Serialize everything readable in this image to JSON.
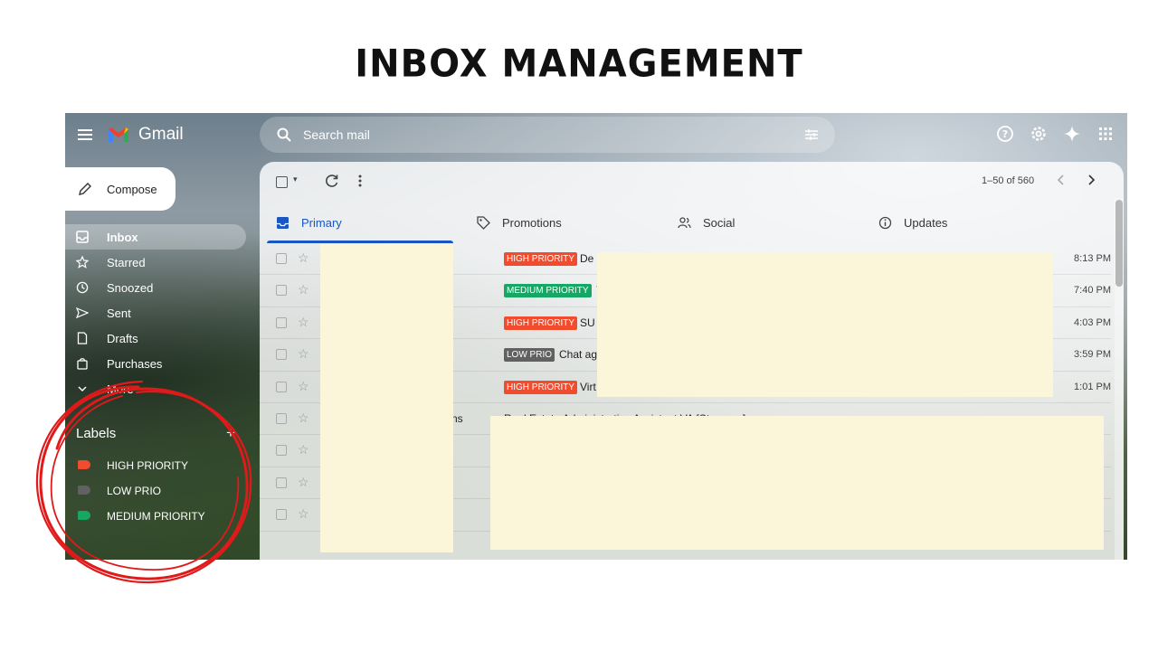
{
  "slide": {
    "title": "INBOX MANAGEMENT"
  },
  "header": {
    "app_name": "Gmail",
    "search_placeholder": "Search mail",
    "icons": [
      "menu-icon",
      "help-icon",
      "settings-icon",
      "gemini-sparkle-icon",
      "apps-grid-icon",
      "search-icon",
      "filter-icon"
    ]
  },
  "compose": {
    "label": "Compose"
  },
  "sidebar": {
    "items": [
      {
        "label": "Inbox",
        "icon": "inbox-icon",
        "active": true
      },
      {
        "label": "Starred",
        "icon": "star-icon"
      },
      {
        "label": "Snoozed",
        "icon": "clock-icon"
      },
      {
        "label": "Sent",
        "icon": "send-icon"
      },
      {
        "label": "Drafts",
        "icon": "draft-icon"
      },
      {
        "label": "Purchases",
        "icon": "shopping-bag-icon"
      },
      {
        "label": "More",
        "icon": "chevron-down-icon"
      }
    ],
    "labels_heading": "Labels",
    "labels_add": "+",
    "labels": [
      {
        "label": "HIGH PRIORITY",
        "color": "#f14c2e"
      },
      {
        "label": "LOW PRIO",
        "color": "#616161"
      },
      {
        "label": "MEDIUM PRIORITY",
        "color": "#16a765"
      }
    ]
  },
  "toolbar": {
    "page_range": "1–50 of 560",
    "caret": "▾"
  },
  "tabs": [
    {
      "label": "Primary",
      "icon": "inbox-icon",
      "active": true
    },
    {
      "label": "Promotions",
      "icon": "tag-icon"
    },
    {
      "label": "Social",
      "icon": "people-icon"
    },
    {
      "label": "Updates",
      "icon": "info-icon"
    }
  ],
  "emails": [
    {
      "badge": "HIGH PRIORITY",
      "badge_color": "#f14c2e",
      "subject": "De",
      "time": "8:13 PM"
    },
    {
      "badge": "MEDIUM PRIORITY",
      "badge_color": "#16a765",
      "subject": "Y",
      "time": "7:40 PM"
    },
    {
      "badge": "HIGH PRIORITY",
      "badge_color": "#f14c2e",
      "subject": "SU",
      "time": "4:03 PM"
    },
    {
      "badge": "LOW PRIO",
      "badge_color": "#616161",
      "subject": "Chat ag",
      "time": "3:59 PM"
    },
    {
      "badge": "HIGH PRIORITY",
      "badge_color": "#f14c2e",
      "subject": "Virt",
      "time": "1:01 PM"
    },
    {
      "sender_fragment": "ns",
      "subject": "Real Estate Administrative Assistant VA [Stress-...]",
      "time": ""
    },
    {
      "subject": "",
      "time": ""
    },
    {
      "subject": "",
      "time": ""
    },
    {
      "subject": "",
      "time": ""
    }
  ],
  "colors": {
    "accent": "#1a56c2",
    "annotation_circle": "#e01a1a",
    "redaction": "#fbf5da"
  }
}
